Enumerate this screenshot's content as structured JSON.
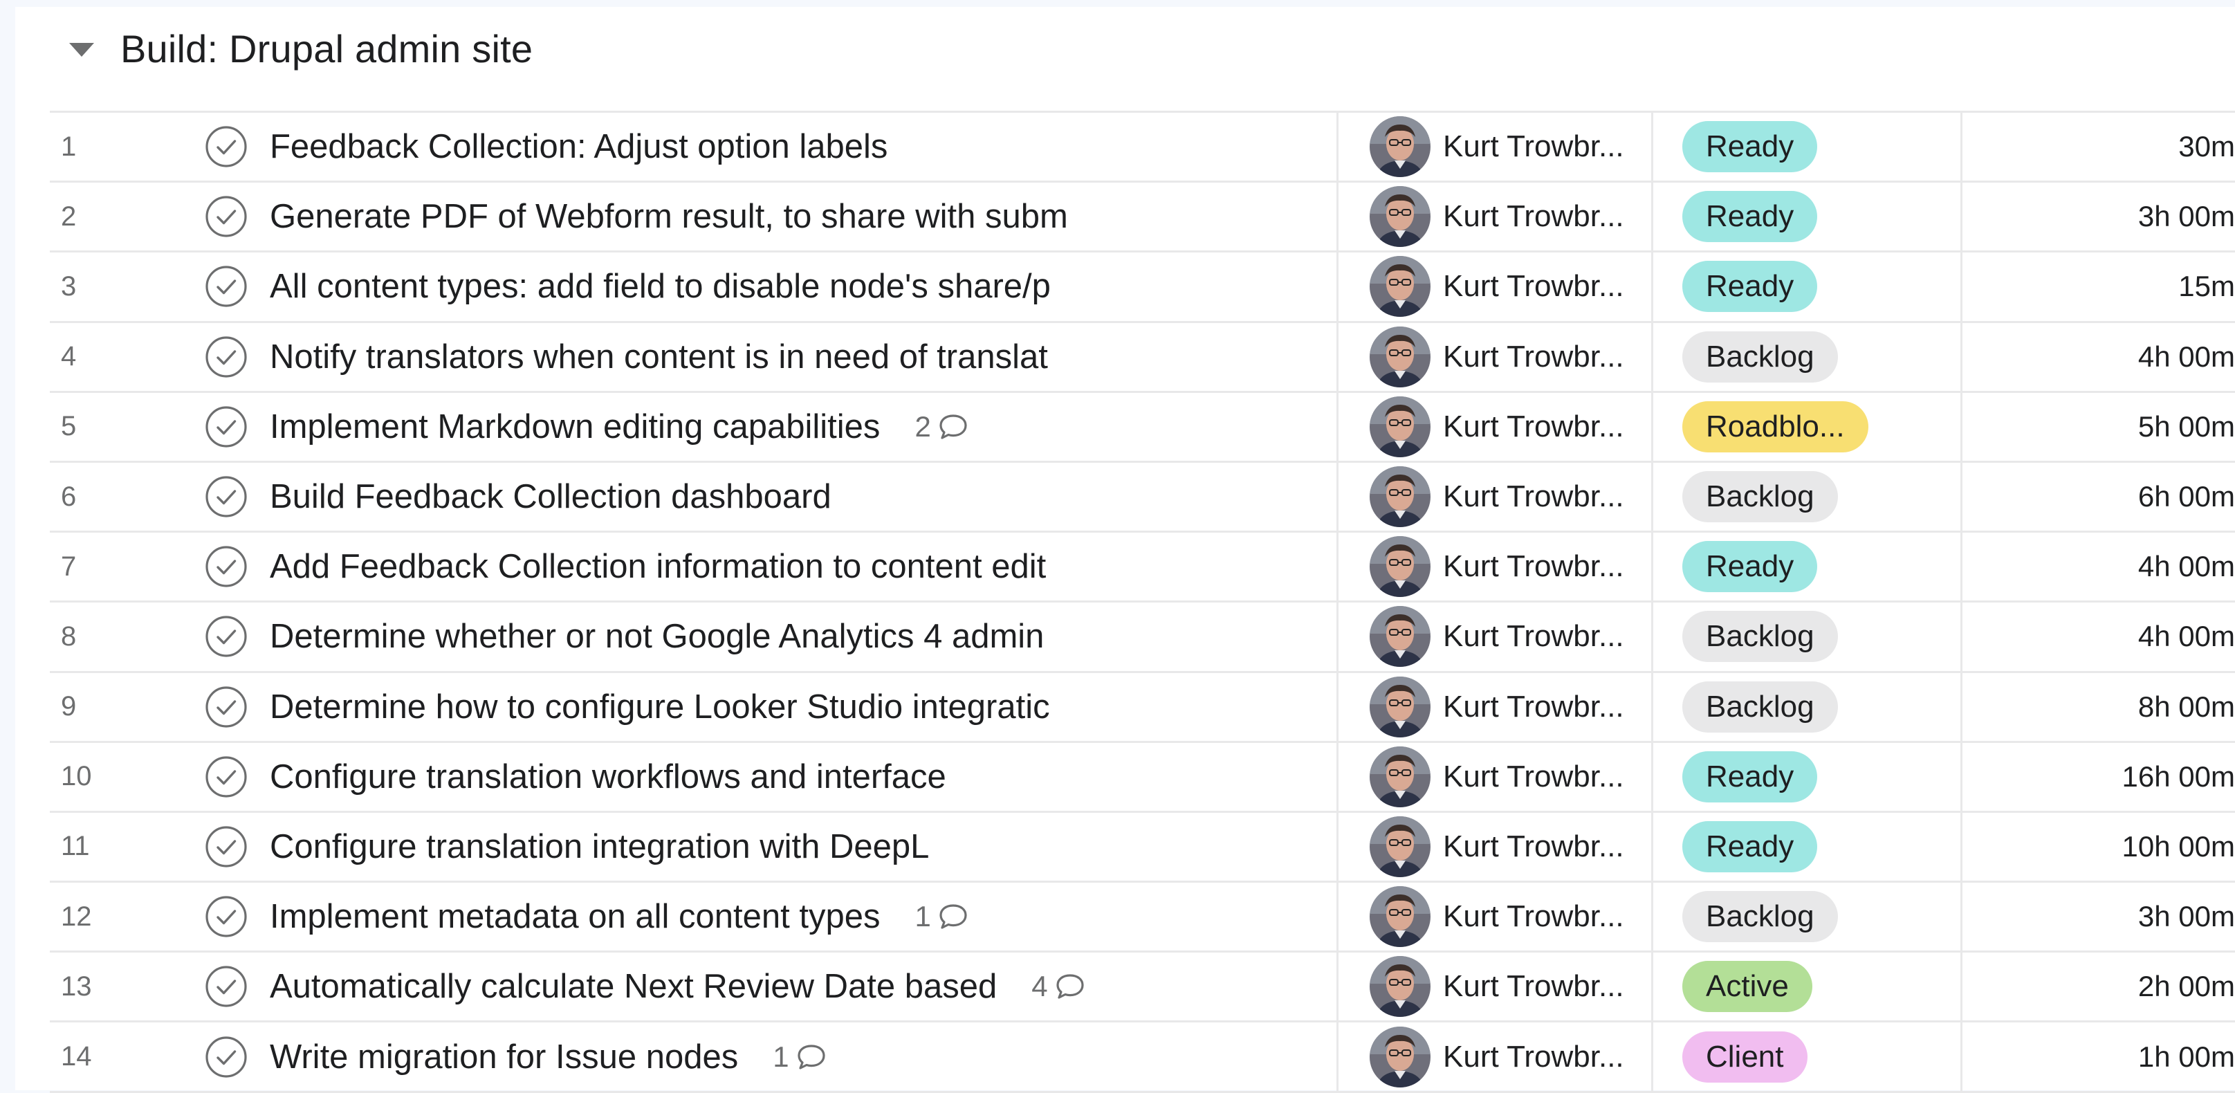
{
  "section": {
    "title": "Build: Drupal admin site",
    "collapse_icon": "caret-down-icon"
  },
  "status_colors": {
    "Ready": {
      "bg": "#9ee7e3",
      "fg": "#1e1f21"
    },
    "Backlog": {
      "bg": "#e8e8e9",
      "fg": "#1e1f21"
    },
    "Roadblo...": {
      "bg": "#f8df72",
      "fg": "#1e1f21"
    },
    "Active": {
      "bg": "#b3df97",
      "fg": "#1e1f21"
    },
    "Client": {
      "bg": "#f1bdf0",
      "fg": "#1e1f21"
    }
  },
  "tasks": [
    {
      "num": "1",
      "name": "Feedback Collection: Adjust option labels",
      "comments": "",
      "assignee": "Kurt Trowbr...",
      "status": "Ready",
      "time": "30m"
    },
    {
      "num": "2",
      "name": "Generate PDF of Webform result, to share with subm",
      "comments": "",
      "assignee": "Kurt Trowbr...",
      "status": "Ready",
      "time": "3h 00m"
    },
    {
      "num": "3",
      "name": "All content types: add field to disable node's share/p",
      "comments": "",
      "assignee": "Kurt Trowbr...",
      "status": "Ready",
      "time": "15m"
    },
    {
      "num": "4",
      "name": "Notify translators when content is in need of translat",
      "comments": "",
      "assignee": "Kurt Trowbr...",
      "status": "Backlog",
      "time": "4h 00m"
    },
    {
      "num": "5",
      "name": "Implement Markdown editing capabilities",
      "comments": "2",
      "assignee": "Kurt Trowbr...",
      "status": "Roadblo...",
      "time": "5h 00m"
    },
    {
      "num": "6",
      "name": "Build Feedback Collection dashboard",
      "comments": "",
      "assignee": "Kurt Trowbr...",
      "status": "Backlog",
      "time": "6h 00m"
    },
    {
      "num": "7",
      "name": "Add Feedback Collection information to content edit",
      "comments": "",
      "assignee": "Kurt Trowbr...",
      "status": "Ready",
      "time": "4h 00m"
    },
    {
      "num": "8",
      "name": "Determine whether or not Google Analytics 4 admin",
      "comments": "",
      "assignee": "Kurt Trowbr...",
      "status": "Backlog",
      "time": "4h 00m"
    },
    {
      "num": "9",
      "name": "Determine how to configure Looker Studio integratic",
      "comments": "",
      "assignee": "Kurt Trowbr...",
      "status": "Backlog",
      "time": "8h 00m"
    },
    {
      "num": "10",
      "name": "Configure translation workflows and interface",
      "comments": "",
      "assignee": "Kurt Trowbr...",
      "status": "Ready",
      "time": "16h 00m"
    },
    {
      "num": "11",
      "name": "Configure translation integration with DeepL",
      "comments": "",
      "assignee": "Kurt Trowbr...",
      "status": "Ready",
      "time": "10h 00m"
    },
    {
      "num": "12",
      "name": "Implement metadata on all content types",
      "comments": "1",
      "assignee": "Kurt Trowbr...",
      "status": "Backlog",
      "time": "3h 00m"
    },
    {
      "num": "13",
      "name": "Automatically calculate Next Review Date based",
      "comments": "4",
      "assignee": "Kurt Trowbr...",
      "status": "Active",
      "time": "2h 00m"
    },
    {
      "num": "14",
      "name": "Write migration for Issue nodes",
      "comments": "1",
      "assignee": "Kurt Trowbr...",
      "status": "Client",
      "time": "1h 00m"
    }
  ]
}
